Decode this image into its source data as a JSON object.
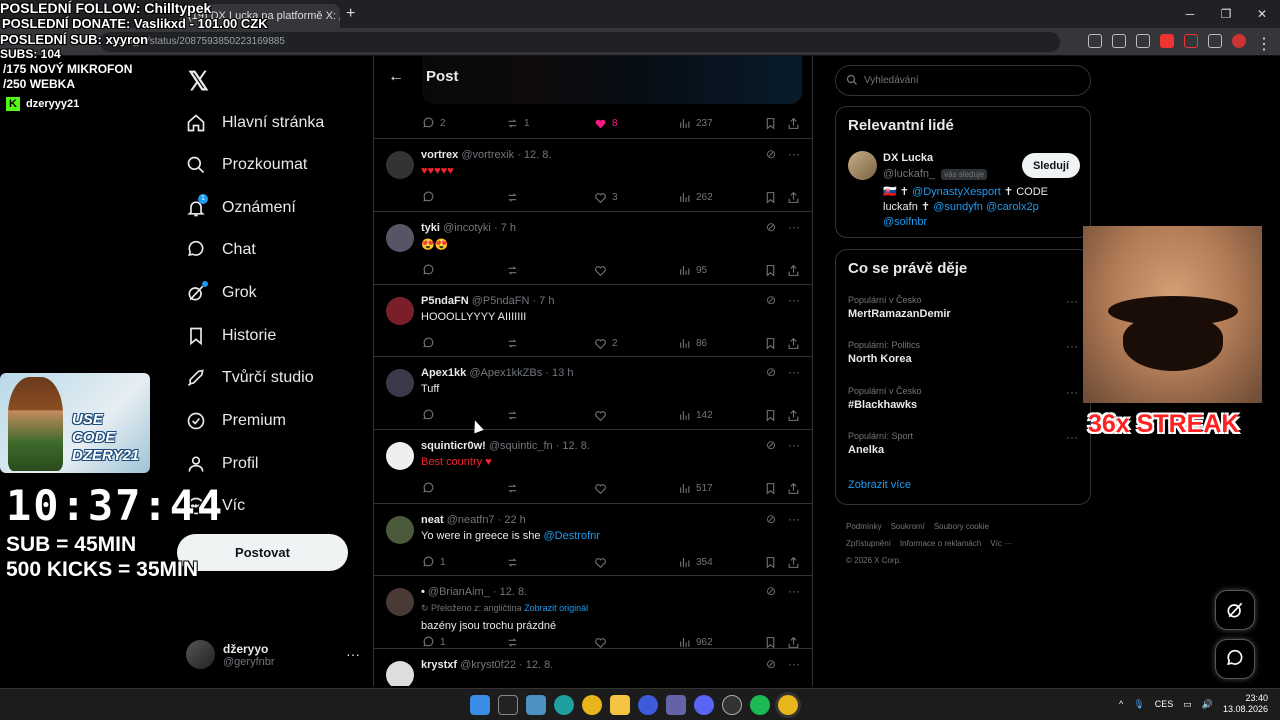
{
  "browser": {
    "tab_title": "(19) DX Lucka na platformě X: „...",
    "url": "ucka_fn/status/2087593850223169885"
  },
  "overlay": {
    "last_follow": "POSLEDNÍ FOLLOW: Chilltypek",
    "last_donate": "POSLEDNÍ DONATE: Vaslikxd - 101.00 CZK",
    "last_sub": "POSLEDNÍ SUB: xyyron",
    "subs": "SUBS: 104",
    "goal1": "/175 NOVÝ MIKROFON",
    "goal2": "/250 WEBKA",
    "kick_user": "dzeryyy21",
    "use_code_1": "USE CODE",
    "use_code_2": "DZERY21",
    "timer": "10:37:44",
    "rule1": "SUB = 45MIN",
    "rule2": "500 KICKS = 35MIN",
    "streak": "36x STREAK"
  },
  "nav": {
    "items": [
      {
        "label": "Hlavní stránka",
        "icon": "home-icon"
      },
      {
        "label": "Prozkoumat",
        "icon": "search-icon"
      },
      {
        "label": "Oznámení",
        "icon": "bell-icon",
        "badge": "1"
      },
      {
        "label": "Chat",
        "icon": "chat-icon"
      },
      {
        "label": "Grok",
        "icon": "grok-icon"
      },
      {
        "label": "Historie",
        "icon": "bookmark-icon"
      },
      {
        "label": "Tvůrčí studio",
        "icon": "rocket-icon"
      },
      {
        "label": "Premium",
        "icon": "verified-icon"
      },
      {
        "label": "Profil",
        "icon": "person-icon"
      },
      {
        "label": "Víc",
        "icon": "more-icon"
      }
    ],
    "post_button": "Postovat",
    "account_name": "džeryyo",
    "account_handle": "@geryfnbr"
  },
  "main": {
    "title": "Post",
    "top_actions": {
      "replies": "2",
      "reposts": "1",
      "likes": "8",
      "views": "237"
    },
    "tweets": [
      {
        "name": "vortrex",
        "handle": "@vortrexik",
        "time": "12. 8.",
        "text": "♥♥♥♥♥",
        "replies": "",
        "likes": "3",
        "views": "262"
      },
      {
        "name": "tyki",
        "handle": "@incotyki",
        "time": "7 h",
        "text": "😍😍",
        "replies": "",
        "likes": "",
        "views": "95"
      },
      {
        "name": "P5ndaFN",
        "handle": "@P5ndaFN",
        "time": "7 h",
        "text": "HOOOLLYYYY AIIIIIII",
        "replies": "",
        "likes": "2",
        "views": "86"
      },
      {
        "name": "Apex1kk",
        "handle": "@Apex1kkZBs",
        "time": "13 h",
        "text": "Tuff",
        "replies": "",
        "likes": "",
        "views": "142"
      },
      {
        "name": "squinticr0w!",
        "handle": "@squintic_fn",
        "time": "12. 8.",
        "text": "Best country ♥",
        "replies": "",
        "likes": "",
        "views": "517"
      },
      {
        "name": "neat",
        "handle": "@neatfn7",
        "time": "22 h",
        "text": "Yo were in greece is she",
        "mention": "@Destrofnr",
        "replies": "1",
        "likes": "",
        "views": "354"
      },
      {
        "name": "•",
        "handle": "@BrianAim_",
        "time": "12. 8.",
        "translated": "Přeloženo z: angličtina",
        "show_original": "Zobrazit originál",
        "text": "bazény jsou trochu prázdné",
        "replies": "1",
        "likes": "",
        "views": "962"
      },
      {
        "name": "krystxf",
        "handle": "@kryst0f22",
        "time": "12. 8.",
        "text": ""
      }
    ]
  },
  "right": {
    "search_placeholder": "Vyhledávání",
    "relevant_title": "Relevantní lidé",
    "person_name": "DX Lucka",
    "person_handle": "@luckafn_",
    "follows_you": "vás sleduje",
    "follow_button": "Sledují",
    "bio_1": "🇸🇰 ✝",
    "bio_link1": "@DynastyXesport",
    "bio_2": "✝ CODE",
    "bio_3": "luckafn ✝",
    "bio_link2": "@sundyfn",
    "bio_link3": "@carolx2p",
    "bio_link4": "@solfnbr",
    "trends_title": "Co se právě děje",
    "trends": [
      {
        "meta": "Populární v Česko",
        "name": "MertRamazanDemir"
      },
      {
        "meta": "Populární: Politics",
        "name": "North Korea"
      },
      {
        "meta": "Populární v Česko",
        "name": "#Blackhawks"
      },
      {
        "meta": "Populární: Sport",
        "name": "Anelka"
      }
    ],
    "show_more": "Zobrazit více",
    "footer": [
      "Podmínky",
      "Soukromí",
      "Soubory cookie",
      "Zpřístupnění",
      "Informace o reklamách",
      "Víc ···",
      "© 2026 X Corp."
    ]
  },
  "taskbar": {
    "lang": "CES",
    "time": "23:40",
    "date": "13.08.2026"
  }
}
